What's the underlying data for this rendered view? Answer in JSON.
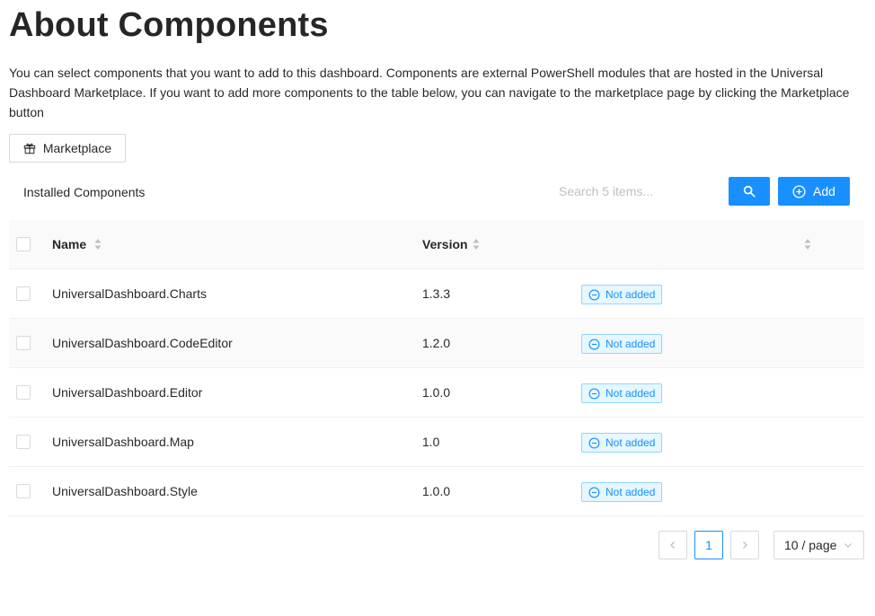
{
  "page": {
    "title": "About Components",
    "intro": "You can select components that you want to add to this dashboard. Components are external PowerShell modules that are hosted in the Universal Dashboard Marketplace. If you want to add more components to the table below, you can navigate to the marketplace page by clicking the Marketplace button"
  },
  "toolbar": {
    "marketplace_label": "Marketplace",
    "marketplace_icon": "gift-icon",
    "section_title": "Installed Components",
    "search_placeholder": "Search 5 items...",
    "search_icon": "search-icon",
    "add_label": "Add",
    "add_icon": "plus-circle-icon"
  },
  "table": {
    "columns": [
      "Name",
      "Version",
      ""
    ],
    "rows": [
      {
        "name": "UniversalDashboard.Charts",
        "version": "1.3.3",
        "status": "Not added"
      },
      {
        "name": "UniversalDashboard.CodeEditor",
        "version": "1.2.0",
        "status": "Not added"
      },
      {
        "name": "UniversalDashboard.Editor",
        "version": "1.0.0",
        "status": "Not added"
      },
      {
        "name": "UniversalDashboard.Map",
        "version": "1.0",
        "status": "Not added"
      },
      {
        "name": "UniversalDashboard.Style",
        "version": "1.0.0",
        "status": "Not added"
      }
    ]
  },
  "pagination": {
    "current_page": "1",
    "page_size": "10 / page"
  },
  "colors": {
    "primary": "#1890ff",
    "tag_bg": "#e6f7ff",
    "tag_border": "#91d5ff"
  }
}
